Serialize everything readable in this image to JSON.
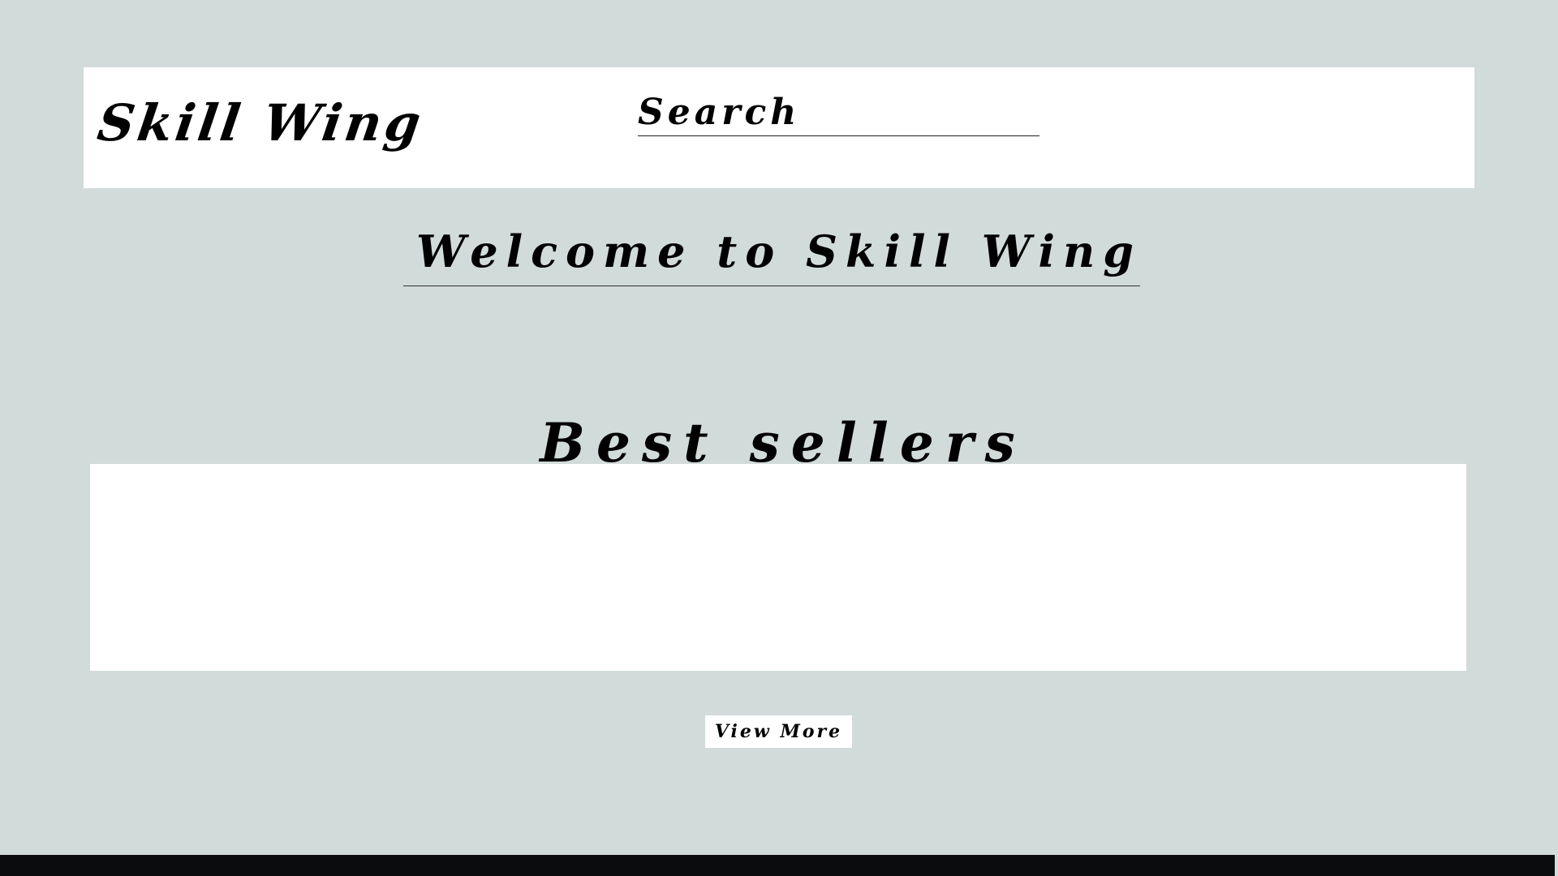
{
  "header": {
    "logo_text": "Skill Wing",
    "search": {
      "placeholder": "Search",
      "value": ""
    }
  },
  "main": {
    "welcome_text": "Welcome to Skill Wing",
    "best_sellers": {
      "title": "Best sellers",
      "view_more_label": "View More"
    }
  },
  "colors": {
    "page_background": "#d1dbda",
    "panel_background": "#ffffff",
    "text": "#000000",
    "footer": "#0a0c0e"
  }
}
